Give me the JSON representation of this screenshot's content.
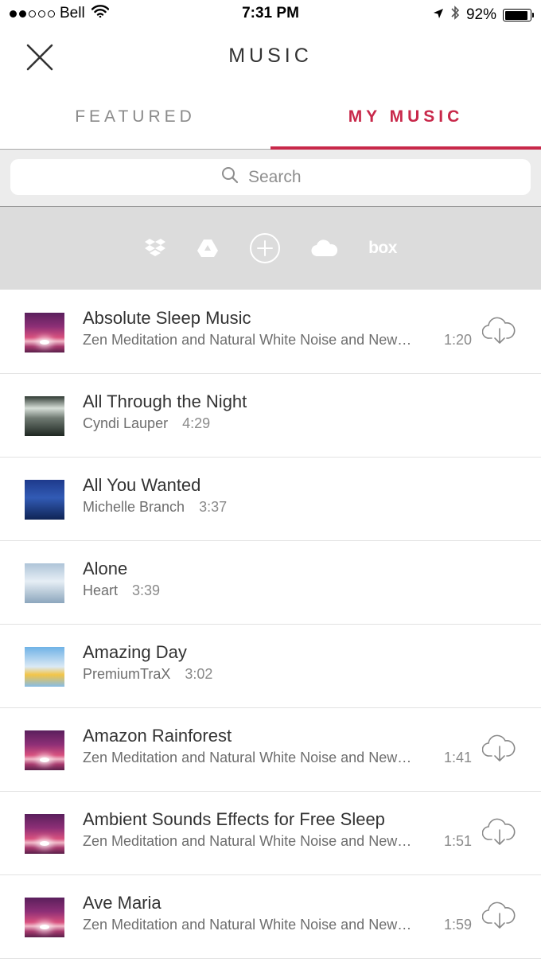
{
  "status_bar": {
    "carrier": "Bell",
    "time": "7:31 PM",
    "battery": "92%",
    "battery_level": 0.92,
    "signal_dots_filled": 2,
    "signal_dots_total": 5
  },
  "header": {
    "title": "MUSIC"
  },
  "tabs": [
    {
      "label": "FEATURED",
      "active": false
    },
    {
      "label": "MY MUSIC",
      "active": true
    }
  ],
  "search": {
    "placeholder": "Search"
  },
  "sources": [
    {
      "name": "Dropbox",
      "icon": "dropbox-icon"
    },
    {
      "name": "Google Drive",
      "icon": "google-drive-icon"
    },
    {
      "name": "Add",
      "icon": "add-circle-icon"
    },
    {
      "name": "iCloud",
      "icon": "cloud-icon"
    },
    {
      "name": "Box",
      "icon": "box-icon",
      "label": "box"
    }
  ],
  "tracks": [
    {
      "title": "Absolute Sleep Music",
      "artist": "Zen Meditation and Natural White Noise and New…",
      "duration": "1:20",
      "art": "serenity",
      "downloadable": true
    },
    {
      "title": "All Through the Night",
      "artist": "Cyndi Lauper",
      "duration": "4:29",
      "art": "night",
      "downloadable": false
    },
    {
      "title": "All You Wanted",
      "artist": "Michelle Branch",
      "duration": "3:37",
      "art": "wanted",
      "downloadable": false
    },
    {
      "title": "Alone",
      "artist": "Heart",
      "duration": "3:39",
      "art": "alone",
      "downloadable": false
    },
    {
      "title": "Amazing Day",
      "artist": "PremiumTraX",
      "duration": "3:02",
      "art": "amazing",
      "downloadable": false
    },
    {
      "title": "Amazon Rainforest",
      "artist": "Zen Meditation and Natural White Noise and New…",
      "duration": "1:41",
      "art": "serenity",
      "downloadable": true
    },
    {
      "title": "Ambient Sounds Effects for Free Sleep",
      "artist": "Zen Meditation and Natural White Noise and New…",
      "duration": "1:51",
      "art": "serenity",
      "downloadable": true
    },
    {
      "title": "Ave Maria",
      "artist": "Zen Meditation and Natural White Noise and New…",
      "duration": "1:59",
      "art": "serenity",
      "downloadable": true
    }
  ],
  "colors": {
    "accent": "#c8284a",
    "source_bar": "#dcdcdc"
  }
}
